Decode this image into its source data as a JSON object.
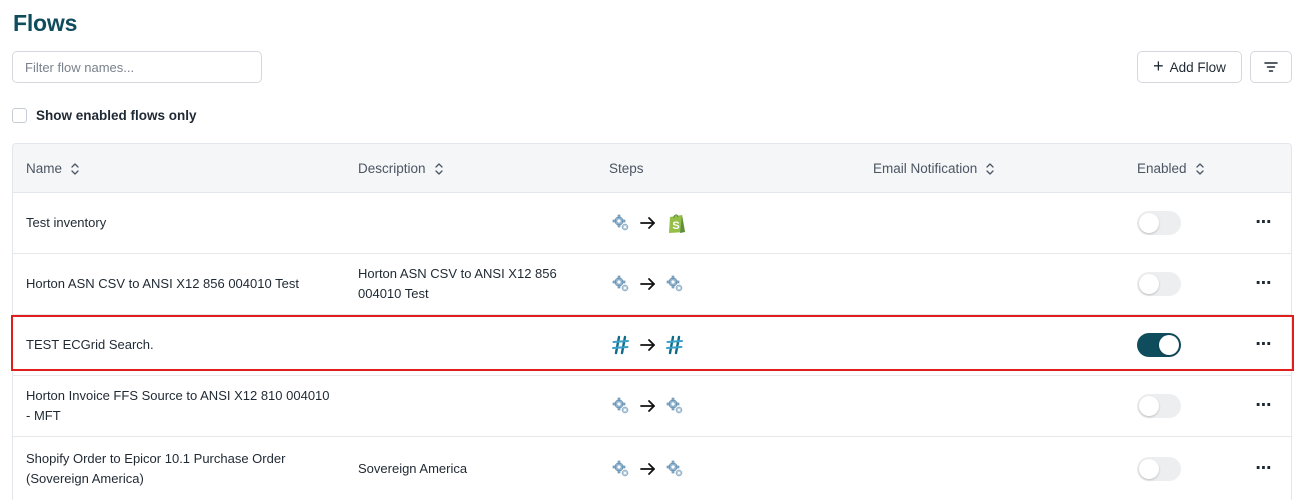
{
  "page": {
    "title": "Flows"
  },
  "filter": {
    "placeholder": "Filter flow names..."
  },
  "toolbar": {
    "add_flow_label": "Add Flow"
  },
  "show_enabled": {
    "label": "Show enabled flows only",
    "checked": false
  },
  "table": {
    "columns": [
      "Name",
      "Description",
      "Steps",
      "Email Notification",
      "Enabled"
    ],
    "rows": [
      {
        "name": "Test inventory",
        "description": "",
        "steps": [
          "gear-icon",
          "shopify-icon"
        ],
        "enabled": false
      },
      {
        "name": "Horton ASN CSV to ANSI X12 856 004010 Test",
        "description": "Horton ASN CSV to ANSI X12 856 004010 Test",
        "steps": [
          "gear-icon",
          "gear-icon"
        ],
        "enabled": false
      },
      {
        "name": "TEST ECGrid Search.",
        "description": "",
        "steps": [
          "ecgrid-icon",
          "ecgrid-icon"
        ],
        "enabled": true
      },
      {
        "name": "Horton Invoice FFS Source to ANSI X12 810 004010 - MFT",
        "description": "",
        "steps": [
          "gear-icon",
          "gear-icon"
        ],
        "enabled": false
      },
      {
        "name": "Shopify Order to Epicor 10.1 Purchase Order (Sovereign America)",
        "description": "Sovereign America",
        "steps": [
          "gear-icon",
          "gear-icon"
        ],
        "enabled": false
      }
    ]
  },
  "colors": {
    "brand": "#0f4c5c",
    "highlight": "#e01e1e",
    "shopify": "#95bf47"
  }
}
